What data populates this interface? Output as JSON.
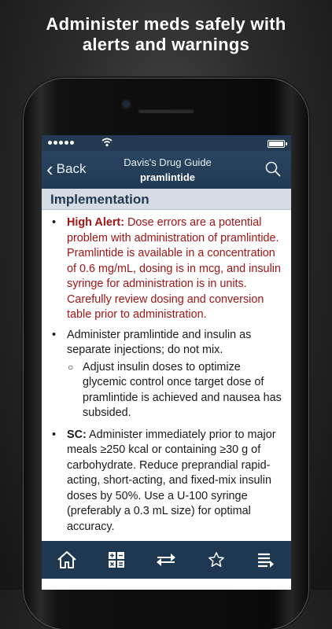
{
  "promo": {
    "line1": "Administer meds safely with",
    "line2": "alerts and warnings"
  },
  "navbar": {
    "back_label": "Back",
    "title": "Davis's Drug Guide",
    "subtitle": "pramlintide"
  },
  "section": {
    "title": "Implementation"
  },
  "content": {
    "bullet1_label": "High Alert:",
    "bullet1_text": " Dose errors are a potential problem with administration of pramlintide. Pramlintide is available in a concentration of 0.6 mg/mL, dosing is in mcg, and insulin syringe for administration is in units. Carefully review dosing and conversion table prior to administration.",
    "bullet2_text": "Administer pramlintide and insulin as separate injections; do not mix.",
    "sub1_text": "Adjust insulin doses to optimize glycemic control once target dose of pramlintide is achieved and nausea has subsided.",
    "bullet3_label": "SC:",
    "bullet3_text": " Administer immediately prior to major meals ≥250 kcal or containing ≥30 g of carbohydrate. Reduce preprandial rapid-acting, short-acting, and fixed-mix insulin doses by 50%. Use a U-100 syringe (preferably a 0.3 mL size) for optimal accuracy."
  },
  "tabbar": {
    "icons": [
      "home-icon",
      "calculator-icon",
      "swap-icon",
      "star-icon",
      "list-icon"
    ]
  },
  "colors": {
    "navbar": "#213a54",
    "alert": "#a31515",
    "section_bg": "#d6dce3"
  }
}
